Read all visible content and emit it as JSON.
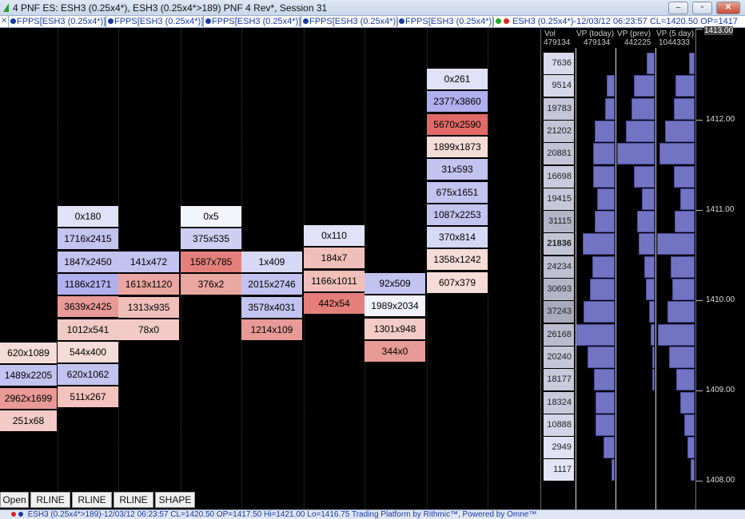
{
  "window": {
    "title": "4 PNF ES: ESH3 (0.25x4*), ESH3 (0.25x4*>189) PNF 4 Rev*, Session 31",
    "buttons": {
      "minimize": "–",
      "restore": "▫",
      "close": "✕"
    }
  },
  "tabs": {
    "close_label": "×",
    "items": [
      "FPPS[ESH3 (0.25x4*)]",
      "FPPS[ESH3 (0.25x4*)]",
      "FPPS[ESH3 (0.25x4*)]",
      "FPPS[ESH3 (0.25x4*)]",
      "FPPS[ESH3 (0.25x4*)]"
    ],
    "series_label": "ESH3 (0.25x4*)-12/03/12 06:23:57 CL=1420.50 OP=1417"
  },
  "footprint": {
    "columns": [
      {
        "cells": [
          {
            "text": "620x1089",
            "color": "#f5dcd7"
          },
          {
            "text": "1489x2205",
            "color": "#c3c3f0"
          },
          {
            "text": "2962x1699",
            "color": "#e89a96"
          },
          {
            "text": "251x68",
            "color": "#f3cbc6"
          }
        ]
      },
      {
        "cells": [
          {
            "text": "0x180",
            "color": "#e1e1f8"
          },
          {
            "text": "1716x2415",
            "color": "#c3c3f0"
          },
          {
            "text": "1847x2450",
            "color": "#c3c3f0"
          },
          {
            "text": "1186x2171",
            "color": "#b0b0ee"
          },
          {
            "text": "3639x2425",
            "color": "#e89a96"
          },
          {
            "text": "1012x541",
            "color": "#f0cbc6"
          },
          {
            "text": "544x400",
            "color": "#f5dcd7"
          },
          {
            "text": "620x1062",
            "color": "#c3c3f0"
          },
          {
            "text": "511x267",
            "color": "#f3c2bc"
          }
        ]
      },
      {
        "cells": [
          {
            "text": "141x472",
            "color": "#c3c3f0"
          },
          {
            "text": "1613x1120",
            "color": "#eaa6a1"
          },
          {
            "text": "1313x935",
            "color": "#f0bfba"
          },
          {
            "text": "78x0",
            "color": "#f3cbc6"
          }
        ]
      },
      {
        "cells": [
          {
            "text": "0x5",
            "color": "#f4f4fc"
          },
          {
            "text": "375x535",
            "color": "#cfcff4"
          },
          {
            "text": "1587x785",
            "color": "#e47f7b"
          },
          {
            "text": "376x2",
            "color": "#eaa6a1"
          }
        ]
      },
      {
        "cells": [
          {
            "text": "1x409",
            "color": "#d7d7f6"
          },
          {
            "text": "2015x2746",
            "color": "#c3c3f0"
          },
          {
            "text": "3578x4031",
            "color": "#c3c3f0"
          },
          {
            "text": "1214x109",
            "color": "#e89a96"
          }
        ]
      },
      {
        "cells": [
          {
            "text": "0x110",
            "color": "#e1e1f8"
          },
          {
            "text": "184x7",
            "color": "#f0bfba"
          },
          {
            "text": "1166x1011",
            "color": "#f0bfba"
          },
          {
            "text": "442x54",
            "color": "#e47f7b"
          }
        ]
      },
      {
        "cells": [
          {
            "text": "92x509",
            "color": "#c3c3f0"
          },
          {
            "text": "1989x2034",
            "color": "#f2f2fc"
          },
          {
            "text": "1301x948",
            "color": "#f3cbc6"
          },
          {
            "text": "344x0",
            "color": "#e89a96"
          }
        ]
      },
      {
        "cells": [
          {
            "text": "0x261",
            "color": "#e1e1f8"
          },
          {
            "text": "2377x3860",
            "color": "#b0b0ee"
          },
          {
            "text": "5670x2590",
            "color": "#e06a66"
          },
          {
            "text": "1899x1873",
            "color": "#f5dcd7"
          },
          {
            "text": "31x593",
            "color": "#c3c3f0"
          },
          {
            "text": "675x1651",
            "color": "#c3c3f0"
          },
          {
            "text": "1087x2253",
            "color": "#c3c3f0"
          },
          {
            "text": "370x814",
            "color": "#d7d7f6"
          },
          {
            "text": "1358x1242",
            "color": "#f5dcd7"
          },
          {
            "text": "607x379",
            "color": "#f5dcd7"
          }
        ]
      }
    ]
  },
  "volume_panel": {
    "headers": {
      "vol": "Vol",
      "vol_total": "479134",
      "today": "VP (today)",
      "today_total": "479134",
      "prev": "VP (prev)",
      "prev_total": "442225",
      "five_day": "VP (5 day)",
      "five_day_total": "1044333"
    },
    "vol_rows": [
      {
        "value": "7636",
        "level": 0.2,
        "highlight": false
      },
      {
        "value": "9514",
        "level": 0.25,
        "highlight": false
      },
      {
        "value": "19783",
        "level": 0.53,
        "highlight": false
      },
      {
        "value": "21202",
        "level": 0.57,
        "highlight": false
      },
      {
        "value": "20881",
        "level": 0.56,
        "highlight": false
      },
      {
        "value": "16698",
        "level": 0.45,
        "highlight": false
      },
      {
        "value": "19415",
        "level": 0.52,
        "highlight": false
      },
      {
        "value": "31115",
        "level": 0.84,
        "highlight": false
      },
      {
        "value": "21836",
        "level": 0.59,
        "highlight": true
      },
      {
        "value": "24234",
        "level": 0.65,
        "highlight": false
      },
      {
        "value": "30693",
        "level": 0.82,
        "highlight": false
      },
      {
        "value": "37243",
        "level": 1.0,
        "highlight": false
      },
      {
        "value": "26168",
        "level": 0.7,
        "highlight": false
      },
      {
        "value": "20240",
        "level": 0.54,
        "highlight": false
      },
      {
        "value": "18177",
        "level": 0.49,
        "highlight": false
      },
      {
        "value": "18324",
        "level": 0.49,
        "highlight": false
      },
      {
        "value": "10888",
        "level": 0.29,
        "highlight": false
      },
      {
        "value": "2949",
        "level": 0.08,
        "highlight": false
      },
      {
        "value": "1117",
        "level": 0.03,
        "highlight": false
      }
    ],
    "vp_today": [
      0.0,
      0.2,
      0.26,
      0.53,
      0.57,
      0.56,
      0.45,
      0.52,
      0.84,
      0.59,
      0.65,
      0.82,
      1.0,
      0.7,
      0.54,
      0.49,
      0.49,
      0.29,
      0.08
    ],
    "vp_prev": [
      0.2,
      0.55,
      0.6,
      0.75,
      0.98,
      0.55,
      0.33,
      0.45,
      0.42,
      0.28,
      0.22,
      0.14,
      0.1,
      0.05,
      0.02,
      0.0,
      0.0,
      0.0,
      0.0
    ],
    "vp_5day": [
      0.15,
      0.5,
      0.55,
      0.78,
      0.92,
      0.55,
      0.38,
      0.52,
      0.98,
      0.62,
      0.58,
      0.7,
      0.95,
      0.66,
      0.48,
      0.38,
      0.28,
      0.18,
      0.1
    ]
  },
  "price_axis": {
    "top_label": "1413.00",
    "labels": [
      "1412.00",
      "1411.00",
      "1410.00",
      "1409.00",
      "1408.00"
    ]
  },
  "toolbar": {
    "buttons": [
      "Open",
      "RLINE",
      "RLINE",
      "RLINE",
      "SHAPE"
    ]
  },
  "status": {
    "text": "ESH3 (0.25x4*>189)-12/03/12 06:23:57 CL=1420.50 OP=1417.50 Hi=1421.00 Lo=1416.75   Trading Platform by Rithmic™, Powered by Omne™"
  }
}
